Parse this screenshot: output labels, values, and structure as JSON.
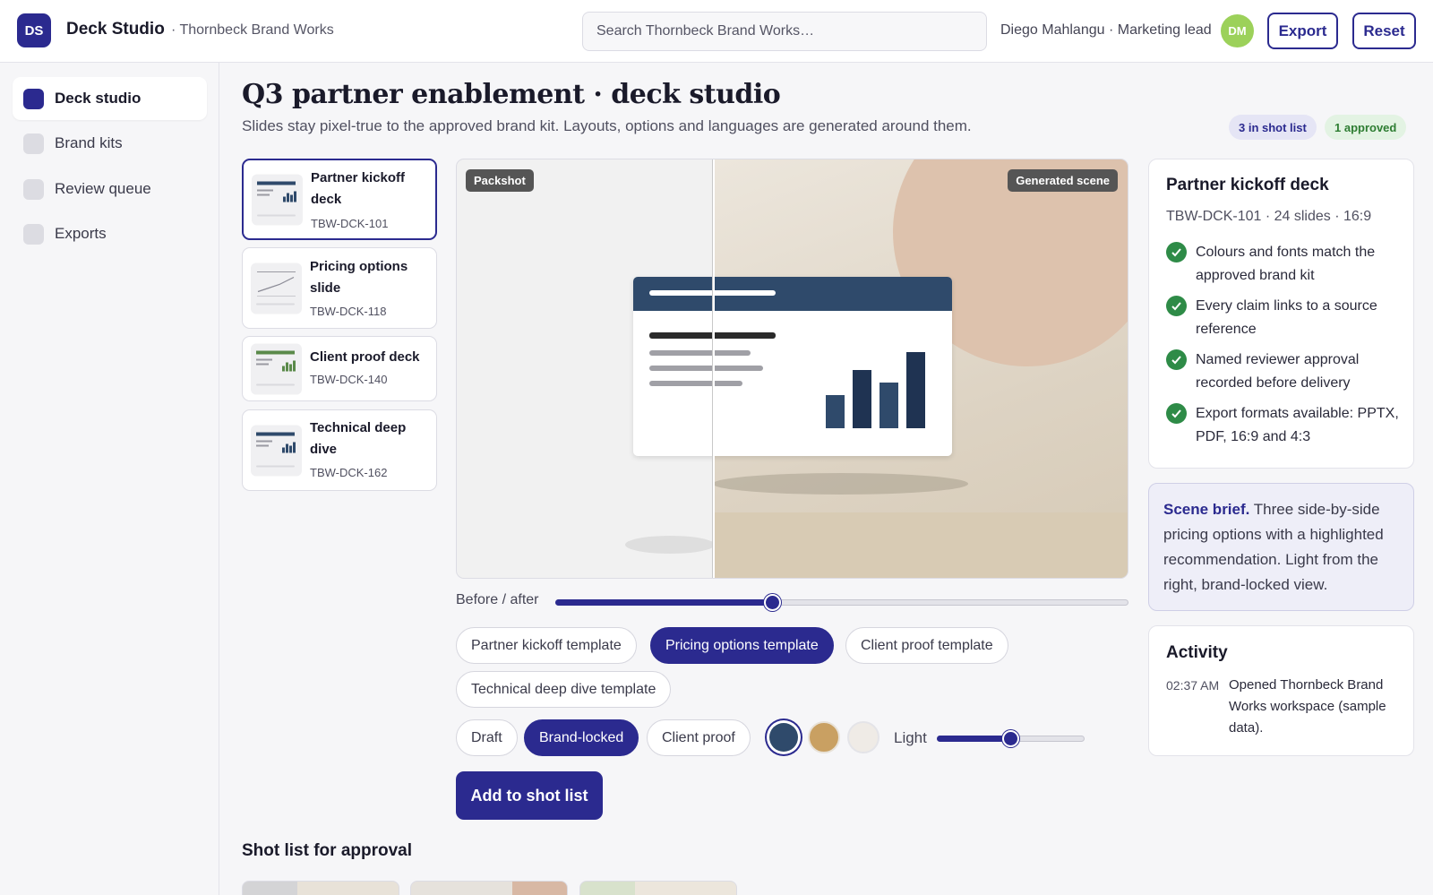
{
  "header": {
    "logo_initials": "DS",
    "app_name": "Deck Studio",
    "workspace": "· Thornbeck Brand Works",
    "search_placeholder": "Search Thornbeck Brand Works…",
    "user_label": "Diego Mahlangu · Marketing lead",
    "avatar_initials": "DM",
    "export_label": "Export",
    "reset_label": "Reset"
  },
  "sidebar": {
    "items": [
      {
        "label": "Deck studio",
        "active": true
      },
      {
        "label": "Brand kits",
        "active": false
      },
      {
        "label": "Review queue",
        "active": false
      },
      {
        "label": "Exports",
        "active": false
      }
    ]
  },
  "page": {
    "title": "Q3 partner enablement · deck studio",
    "subtitle": "Slides stay pixel-true to the approved brand kit. Layouts, options and languages are generated around them.",
    "badge_shot_list": "3 in shot list",
    "badge_approved": "1 approved"
  },
  "decks": [
    {
      "title": "Partner kickoff deck",
      "code": "TBW-DCK-101",
      "thumb": "bars"
    },
    {
      "title": "Pricing options slide",
      "code": "TBW-DCK-118",
      "thumb": "line"
    },
    {
      "title": "Client proof deck",
      "code": "TBW-DCK-140",
      "thumb": "bars-green"
    },
    {
      "title": "Technical deep dive",
      "code": "TBW-DCK-162",
      "thumb": "bars"
    }
  ],
  "preview": {
    "left_tag": "Packshot",
    "right_tag": "Generated scene",
    "before_after_label": "Before / after",
    "before_after_value": 0.38
  },
  "templates": [
    {
      "label": "Partner kickoff template",
      "active": false
    },
    {
      "label": "Pricing options template",
      "active": true
    },
    {
      "label": "Client proof template",
      "active": false
    },
    {
      "label": "Technical deep dive template",
      "active": false
    }
  ],
  "modes": [
    {
      "label": "Draft",
      "active": false
    },
    {
      "label": "Brand-locked",
      "active": true
    },
    {
      "label": "Client proof",
      "active": false
    }
  ],
  "swatches": [
    {
      "color": "#2f4a6b",
      "selected": true
    },
    {
      "color": "#c9a062",
      "selected": false
    },
    {
      "color": "#efebe6",
      "selected": false
    }
  ],
  "light": {
    "label": "Light",
    "value": 0.5
  },
  "add_button_label": "Add to shot list",
  "shot_list_heading": "Shot list for approval",
  "selected_deck": {
    "title": "Partner kickoff deck",
    "meta": "TBW-DCK-101 · 24 slides · 16:9",
    "checks": [
      "Colours and fonts match the approved brand kit",
      "Every claim links to a source reference",
      "Named reviewer approval recorded before delivery",
      "Export formats available: PPTX, PDF, 16:9 and 4:3"
    ]
  },
  "scene_brief": {
    "label": "Scene brief.",
    "text": " Three side-by-side pricing options with a highlighted recommendation. Light from the right, brand-locked view."
  },
  "activity": {
    "title": "Activity",
    "entries": [
      {
        "time": "02:37 AM",
        "text": "Opened Thornbeck Brand Works workspace (sample data)."
      }
    ]
  },
  "colors": {
    "accent": "#2b2a8f",
    "slide_navy": "#2f4a6b",
    "success": "#2e8b47",
    "avatar": "#9cd15a"
  }
}
